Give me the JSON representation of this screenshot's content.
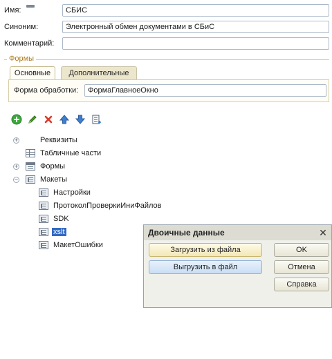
{
  "form": {
    "name_label": "Имя:",
    "name_value": "СБИС",
    "synonym_label": "Синоним:",
    "synonym_value": "Электронный обмен документами в СБиС",
    "comment_label": "Комментарий:",
    "comment_value": ""
  },
  "forms_group": {
    "title": "Формы",
    "tabs": [
      {
        "label": "Основные",
        "active": true
      },
      {
        "label": "Дополнительные",
        "active": false
      }
    ],
    "processing_form_label": "Форма обработки:",
    "processing_form_value": "ФормаГлавноеОкно"
  },
  "toolbar": {
    "icons": [
      "add-icon",
      "edit-icon",
      "delete-icon",
      "move-up-icon",
      "move-down-icon",
      "list-icon"
    ],
    "colors": {
      "add": "#3da83d",
      "edit": "#4aa02c",
      "delete": "#d83a2c",
      "arrows": "#3e7ed0"
    }
  },
  "tree": {
    "items": [
      {
        "label": "Реквизиты",
        "expander": "+",
        "icon": "props-icon"
      },
      {
        "label": "Табличные части",
        "expander": "",
        "icon": "table-icon"
      },
      {
        "label": "Формы",
        "expander": "+",
        "icon": "form-icon"
      },
      {
        "label": "Макеты",
        "expander": "−",
        "icon": "template-icon"
      }
    ],
    "children": [
      {
        "label": "Настройки",
        "icon": "template-icon",
        "selected": false
      },
      {
        "label": "ПротоколПроверкиИниФайлов",
        "icon": "template-icon",
        "selected": false
      },
      {
        "label": "SDK",
        "icon": "template-icon",
        "selected": false
      },
      {
        "label": "xslt",
        "icon": "template-icon",
        "selected": true
      },
      {
        "label": "МакетОшибки",
        "icon": "template-icon",
        "selected": false
      }
    ]
  },
  "dialog": {
    "title": "Двоичные данные",
    "close": "✕",
    "load_button": "Загрузить из файла",
    "save_button": "Выгрузить в файл",
    "ok_button": "OK",
    "cancel_button": "Отмена",
    "help_button": "Справка"
  }
}
